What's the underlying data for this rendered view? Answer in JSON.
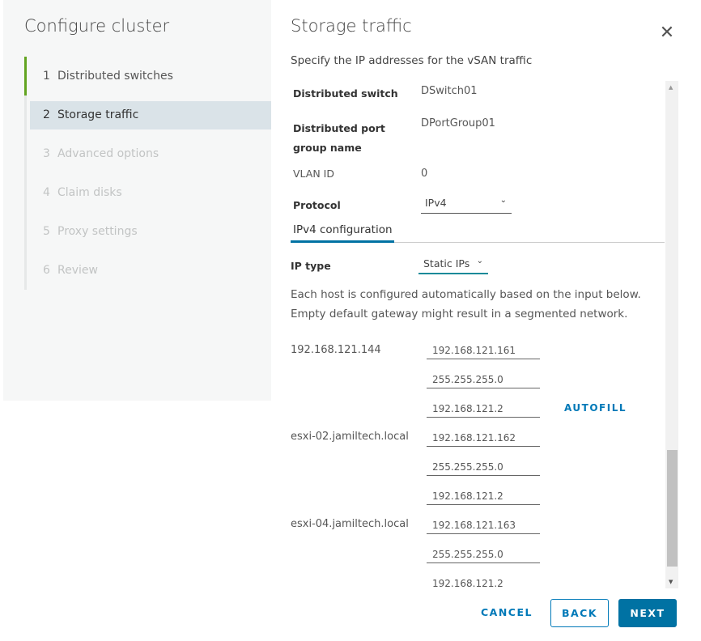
{
  "sidebar": {
    "title": "Configure cluster",
    "steps": [
      {
        "num": "1",
        "label": "Distributed switches",
        "state": "completed"
      },
      {
        "num": "2",
        "label": "Storage traffic",
        "state": "active"
      },
      {
        "num": "3",
        "label": "Advanced options",
        "state": "disabled"
      },
      {
        "num": "4",
        "label": "Claim disks",
        "state": "disabled"
      },
      {
        "num": "5",
        "label": "Proxy settings",
        "state": "disabled"
      },
      {
        "num": "6",
        "label": "Review",
        "state": "disabled"
      }
    ]
  },
  "main": {
    "title": "Storage traffic",
    "close_icon": "close-icon",
    "subtitle": "Specify the IP addresses for the vSAN traffic",
    "fields": {
      "switch_label": "Distributed switch",
      "switch_value": "DSwitch01",
      "portgroup_label": "Distributed port group name",
      "portgroup_value": "DPortGroup01",
      "vlan_label": "VLAN ID",
      "vlan_value": "0",
      "protocol_label": "Protocol",
      "protocol_value": "IPv4"
    },
    "tab": "IPv4 configuration",
    "ip_type_label": "IP type",
    "ip_type_value": "Static IPs",
    "info_line1": "Each host is configured automatically based on the input below.",
    "info_line2": "Empty default gateway might result in a segmented network.",
    "autofill": "AUTOFILL",
    "hosts": [
      {
        "name": "192.168.121.144",
        "ip": "192.168.121.161",
        "mask": "255.255.255.0",
        "gateway": "192.168.121.2"
      },
      {
        "name": "esxi-02.jamiltech.local",
        "ip": "192.168.121.162",
        "mask": "255.255.255.0",
        "gateway": "192.168.121.2"
      },
      {
        "name": "esxi-04.jamiltech.local",
        "ip": "192.168.121.163",
        "mask": "255.255.255.0",
        "gateway": "192.168.121.2"
      }
    ]
  },
  "footer": {
    "cancel": "CANCEL",
    "back": "BACK",
    "next": "NEXT"
  },
  "colors": {
    "accent": "#0072a3",
    "step_complete": "#62a420"
  }
}
